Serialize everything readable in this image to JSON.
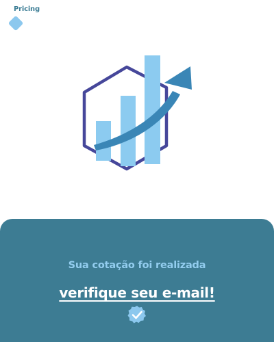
{
  "header": {
    "brand_label": "Pricing"
  },
  "hero": {
    "icon": "growth-chart-icon"
  },
  "confirmation": {
    "subtitle": "Sua cotação foi realizada",
    "title": "verifique seu e-mail!",
    "icon": "verified-check-icon"
  },
  "colors": {
    "panel": "#3d7c93",
    "accent_light": "#8cc8ee",
    "hexagon": "#46479a",
    "arrow": "#3a86b6",
    "title_text": "#ffffff"
  }
}
